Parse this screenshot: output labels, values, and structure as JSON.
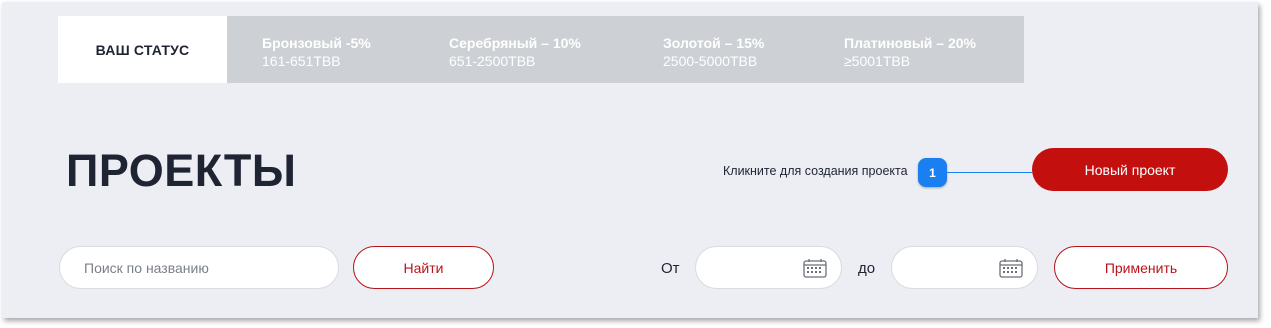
{
  "status": {
    "current_label": "ВАШ СТАТУС",
    "tiers": [
      {
        "name": "Бронзовый -5%",
        "range": "161-651ТВВ"
      },
      {
        "name": "Серебряный – 10%",
        "range": "651-2500ТВВ"
      },
      {
        "name": "Золотой – 15%",
        "range": "2500-5000ТВВ"
      },
      {
        "name": "Платиновый – 20%",
        "range": "≥5001ТВВ"
      }
    ]
  },
  "header": {
    "title": "ПРОЕКТЫ",
    "hint": "Кликните для создания проекта",
    "hint_badge": "1",
    "new_project_label": "Новый проект"
  },
  "filters": {
    "search_placeholder": "Поиск по названию",
    "find_label": "Найти",
    "from_label": "От",
    "to_label": "до",
    "apply_label": "Применить",
    "date_icon": "calendar-icon"
  },
  "colors": {
    "accent": "#c40f0f",
    "hint_blue": "#1a7ff0",
    "status_inactive": "#cdd0d5",
    "background": "#eceef3"
  }
}
